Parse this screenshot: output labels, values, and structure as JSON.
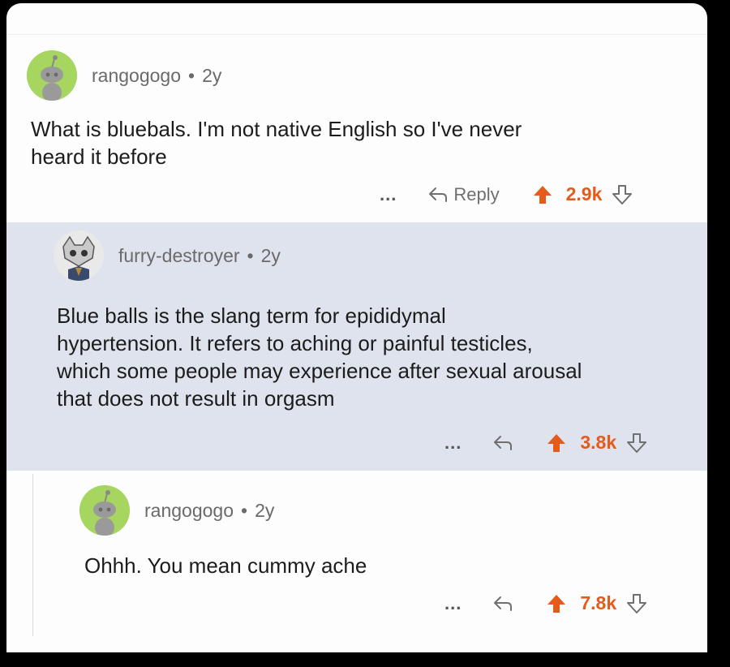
{
  "comments": [
    {
      "username": "rangogogo",
      "separator": "•",
      "age": "2y",
      "text_lines": [
        "What is bluebals. I'm not native English so I've never",
        "heard it before"
      ],
      "more_label": "...",
      "reply_label": "Reply",
      "score": "2.9k"
    },
    {
      "username": "furry-destroyer",
      "separator": "•",
      "age": "2y",
      "text_lines": [
        "Blue balls is the slang term for epididymal",
        "hypertension. It refers to aching or painful testicles,",
        "which some people may experience after sexual arousal",
        "that does not result in orgasm"
      ],
      "more_label": "...",
      "score": "3.8k"
    },
    {
      "username": "rangogogo",
      "separator": "•",
      "age": "2y",
      "text_lines": [
        "Ohhh. You mean cummy ache"
      ],
      "more_label": "...",
      "score": "7.8k"
    }
  ],
  "colors": {
    "upvote": "#e55b1c",
    "highlight_bg": "#dfe3ee",
    "avatar_green": "#a6d65f"
  },
  "icons": {
    "upvote": "upvote-arrow-icon",
    "downvote": "downvote-arrow-icon",
    "reply": "reply-arrow-icon",
    "more": "more-dots-icon"
  }
}
